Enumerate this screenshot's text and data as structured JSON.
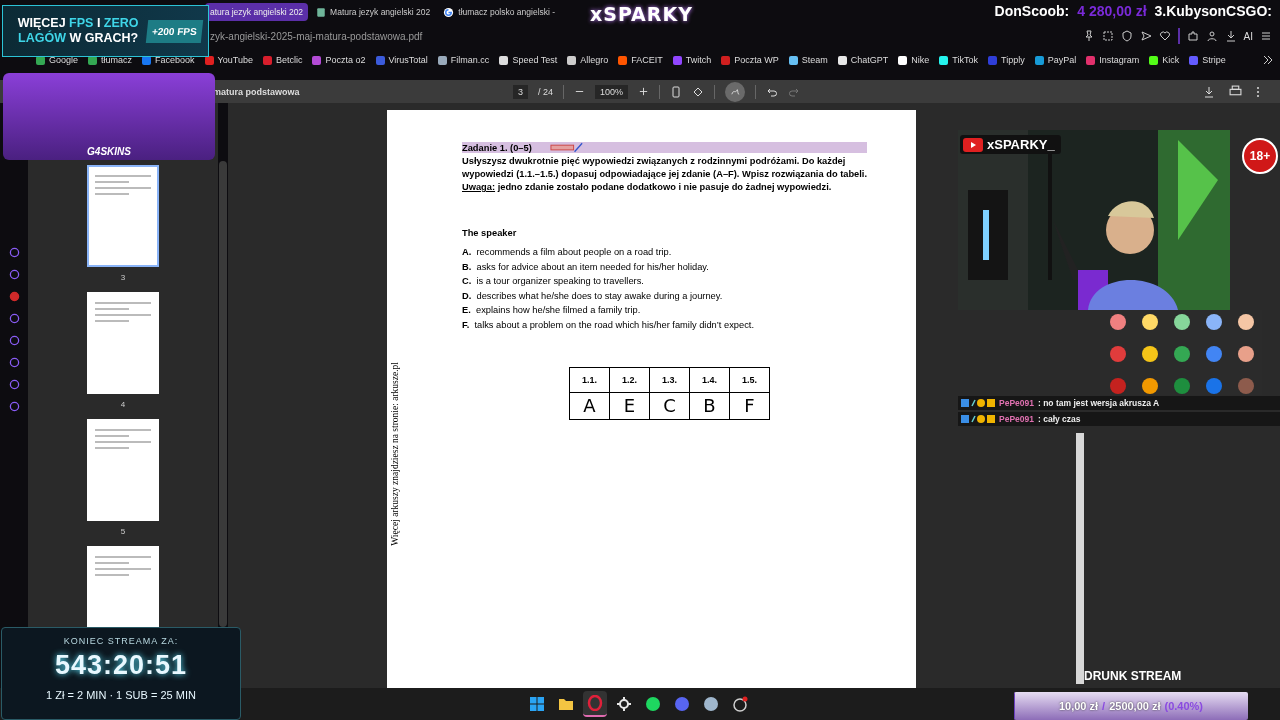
{
  "tabs": [
    {
      "label": "atura jezyk angielski 202",
      "selected": true,
      "kind": "none"
    },
    {
      "label": "Matura jezyk angielski 202",
      "selected": false,
      "kind": "doc"
    },
    {
      "label": "tłumacz polsko angielski -",
      "selected": false,
      "kind": "google"
    }
  ],
  "address": "zyk-angielski-2025-maj-matura-podstawowa.pdf",
  "browser_tools": {
    "ai_label": "AI"
  },
  "bookmarks": [
    {
      "label": "Google",
      "color": "#34a853"
    },
    {
      "label": "tłumacz",
      "color": "#34a853"
    },
    {
      "label": "Facebook",
      "color": "#1877f2"
    },
    {
      "label": "YouTube",
      "color": "#e02020"
    },
    {
      "label": "Betclic",
      "color": "#d81e2c"
    },
    {
      "label": "Poczta o2",
      "color": "#b34bd6"
    },
    {
      "label": "VirusTotal",
      "color": "#3b5bdb"
    },
    {
      "label": "Filman.cc",
      "color": "#9ab"
    },
    {
      "label": "Speed Test",
      "color": "#dddddd"
    },
    {
      "label": "Allegro",
      "color": "#cccccc"
    },
    {
      "label": "FACEIT",
      "color": "#ff5500"
    },
    {
      "label": "Twitch",
      "color": "#9146ff"
    },
    {
      "label": "Poczta WP",
      "color": "#d01f1f"
    },
    {
      "label": "Steam",
      "color": "#66c0f4"
    },
    {
      "label": "ChatGPT",
      "color": "#e8e8e8"
    },
    {
      "label": "Nike",
      "color": "#ffffff"
    },
    {
      "label": "TikTok",
      "color": "#25f4ee"
    },
    {
      "label": "Tipply",
      "color": "#2f3ed8"
    },
    {
      "label": "PayPal",
      "color": "#179bd7"
    },
    {
      "label": "Instagram",
      "color": "#e1306c"
    },
    {
      "label": "Kick",
      "color": "#53fc18"
    },
    {
      "label": "Stripe",
      "color": "#635bff"
    }
  ],
  "pdf_toolbar": {
    "title": "matura podstawowa",
    "page": "3",
    "pages": "/ 24",
    "zoom": "100%",
    "annotate_active": true,
    "redo_disabled": true
  },
  "thumbnails": [
    {
      "label": "3",
      "selected": true
    },
    {
      "label": "4",
      "selected": false
    },
    {
      "label": "5",
      "selected": false
    },
    {
      "selected": false
    }
  ],
  "page": {
    "heading": "Zadanie 1. (0–5)",
    "instruction": "Usłyszysz dwukrotnie pięć wypowiedzi związanych z rodzinnymi podróżami. Do każdej wypowiedzi (1.1.–1.5.) dopasuj odpowiadające jej zdanie (A–F). Wpisz rozwiązania do tabeli.",
    "note_label": "Uwaga:",
    "note": "jedno zdanie zostało podane dodatkowo i nie pasuje do żadnej wypowiedzi.",
    "subheading": "The speaker",
    "options": [
      {
        "letter": "A.",
        "text": "recommends a film about people on a road trip."
      },
      {
        "letter": "B.",
        "text": "asks for advice about an item needed for his/her holiday."
      },
      {
        "letter": "C.",
        "text": "is a tour organizer speaking to travellers."
      },
      {
        "letter": "D.",
        "text": "describes what he/she does to stay awake during a journey."
      },
      {
        "letter": "E.",
        "text": "explains how he/she filmed a family trip."
      },
      {
        "letter": "F.",
        "text": "talks about a problem on the road which his/her family didn’t expect."
      }
    ],
    "table": {
      "columns": [
        "1.1.",
        "1.2.",
        "1.3.",
        "1.4.",
        "1.5."
      ],
      "answers": [
        "A",
        "E",
        "C",
        "B",
        "F"
      ]
    },
    "side_text": "Więcej arkuszy znajdziesz na stronie: arkusze.pl"
  },
  "color_palette": [
    {
      "color": "#f08080"
    },
    {
      "color": "#ffd966"
    },
    {
      "color": "#86d69a"
    },
    {
      "color": "#8ab4f8"
    },
    {
      "color": "#f5c6a5"
    },
    {
      "color": "#e03c3c"
    },
    {
      "color": "#f5c518"
    },
    {
      "color": "#34a853"
    },
    {
      "color": "#4285f4"
    },
    {
      "color": "#e8a08a"
    },
    {
      "color": "#c5221f"
    },
    {
      "color": "#f29900"
    },
    {
      "color": "#1e8e3e"
    },
    {
      "color": "#1a73e8"
    },
    {
      "color": "#8d5b4c"
    }
  ],
  "overlay": {
    "ad": {
      "headline": [
        {
          "text": "WIĘCEJ",
          "accent": false
        },
        {
          "text": "FPS",
          "accent": true
        },
        {
          "text": "I",
          "accent": false
        },
        {
          "text": "ZERO",
          "accent": true
        },
        {
          "text": "LAGÓW",
          "accent": true
        },
        {
          "text": "W GRACH?",
          "accent": false
        }
      ],
      "badge": "+200 FPS"
    },
    "sponsor": "G4SKINS",
    "logo": "xSPARKY",
    "donors": {
      "name": "DonScoob:",
      "amount": "4 280,00 zł",
      "next": "3.KubysonCSGO:"
    },
    "webcam": {
      "channel": "xSPARKY_",
      "age": "18+"
    },
    "chat": [
      {
        "user": "PePe091",
        "message": ": no tam jest wersja akrusza A"
      },
      {
        "user": "PePe091",
        "message": ": cały czas"
      }
    ],
    "caption": "DRUNK STREAM",
    "timer": {
      "title": "KONIEC STREAMA ZA:",
      "time": "543:20:51",
      "rates": "1 Zł = 2 MIN · 1 SUB = 25 MIN"
    },
    "goal": {
      "current": "10,00 zł",
      "separator": "/",
      "target": "2500,00 zł",
      "percent": "(0.40%)",
      "level": 0.004
    }
  },
  "taskbar": [
    {
      "kind": "windows",
      "selected": false
    },
    {
      "kind": "folder",
      "selected": false
    },
    {
      "kind": "opera",
      "selected": true
    },
    {
      "kind": "steelseries",
      "selected": false
    },
    {
      "kind": "spotify",
      "selected": false
    },
    {
      "kind": "discord",
      "selected": false
    },
    {
      "kind": "steam",
      "selected": false
    },
    {
      "kind": "obs",
      "selected": false
    }
  ]
}
